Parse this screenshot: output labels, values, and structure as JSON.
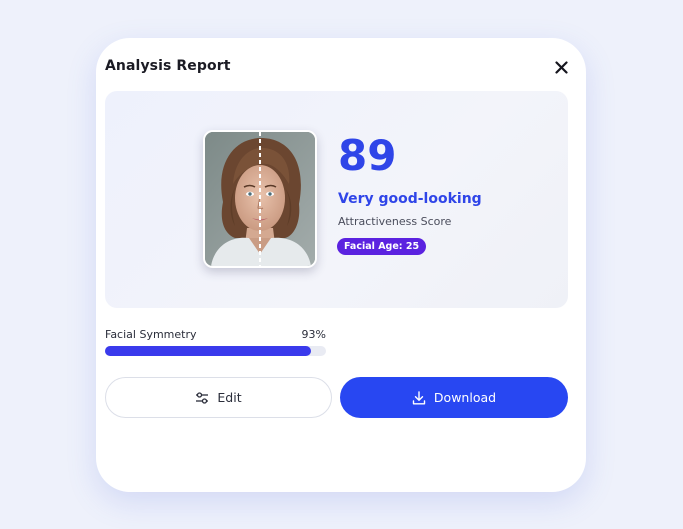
{
  "dialog": {
    "title": "Analysis Report"
  },
  "result": {
    "score": "89",
    "verdict": "Very good-looking",
    "subtitle": "Attractiveness Score",
    "facial_age": "Facial Age: 25"
  },
  "metric": {
    "label": "Facial Symmetry",
    "value_text": "93%",
    "value": 0.93
  },
  "actions": {
    "edit_label": "Edit",
    "download_label": "Download"
  },
  "icons": {
    "close": "close-icon",
    "edit": "sliders-icon",
    "download": "download-icon"
  },
  "colors": {
    "accent": "#2f45e8",
    "badge": "#5b22e0",
    "bar": "#3a3aec",
    "download_button": "#2847f2"
  }
}
